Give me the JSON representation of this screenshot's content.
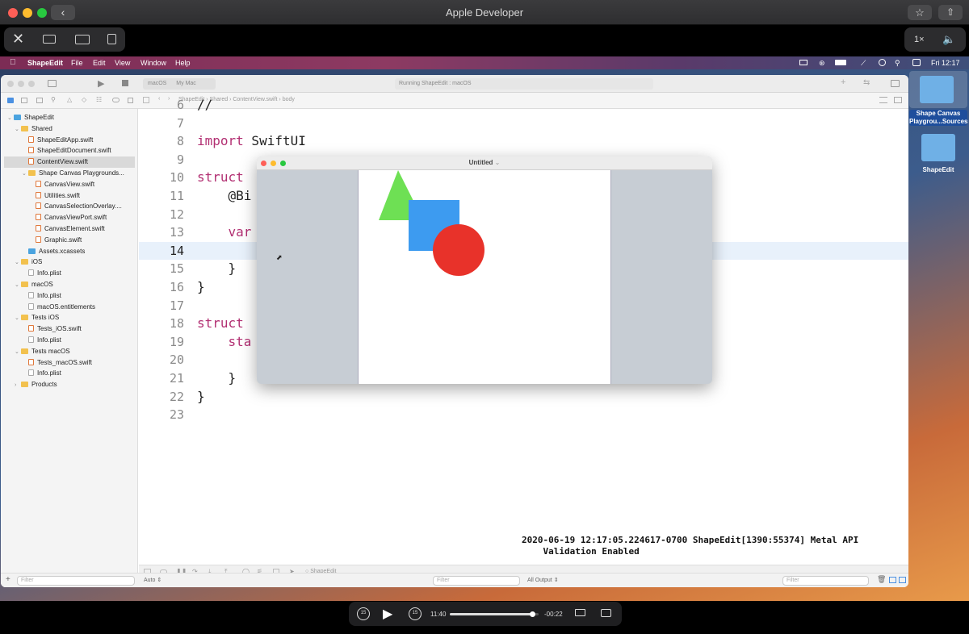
{
  "player": {
    "title": "Apple Developer",
    "speed": "1×",
    "time_elapsed": "11:40",
    "time_remaining": "-00:22",
    "progress": 0.93,
    "skip_back": "15",
    "skip_fwd": "15"
  },
  "menubar": {
    "app": "ShapeEdit",
    "items": [
      "File",
      "Edit",
      "View",
      "Window",
      "Help"
    ],
    "clock": "Fri 12:17"
  },
  "xcode": {
    "scheme_target": "macOS",
    "scheme_device": "My Mac",
    "status": "Running ShapeEdit : macOS",
    "breadcrumb": [
      "ShapeEdit",
      "Shared",
      "ContentView.swift",
      "body"
    ],
    "debug_target": "ShapeEdit",
    "auto_label": "Auto",
    "all_output_label": "All Output",
    "filter_placeholder": "Filter"
  },
  "navigator": [
    {
      "label": "ShapeEdit",
      "icon": "bfold",
      "indent": 0,
      "chev": "v"
    },
    {
      "label": "Shared",
      "icon": "fold",
      "indent": 1,
      "chev": "v"
    },
    {
      "label": "ShapeEditApp.swift",
      "icon": "swift",
      "indent": 2
    },
    {
      "label": "ShapeEditDocument.swift",
      "icon": "swift",
      "indent": 2
    },
    {
      "label": "ContentView.swift",
      "icon": "swift",
      "indent": 2,
      "selected": true
    },
    {
      "label": "Shape Canvas Playgrounds...",
      "icon": "fold",
      "indent": 2,
      "chev": "v"
    },
    {
      "label": "CanvasView.swift",
      "icon": "swift",
      "indent": 3
    },
    {
      "label": "Utilities.swift",
      "icon": "swift",
      "indent": 3
    },
    {
      "label": "CanvasSelectionOverlay....",
      "icon": "swift",
      "indent": 3
    },
    {
      "label": "CanvasViewPort.swift",
      "icon": "swift",
      "indent": 3
    },
    {
      "label": "CanvasElement.swift",
      "icon": "swift",
      "indent": 3
    },
    {
      "label": "Graphic.swift",
      "icon": "swift",
      "indent": 3
    },
    {
      "label": "Assets.xcassets",
      "icon": "bfold",
      "indent": 2
    },
    {
      "label": "iOS",
      "icon": "fold",
      "indent": 1,
      "chev": "v"
    },
    {
      "label": "Info.plist",
      "icon": "plist",
      "indent": 2
    },
    {
      "label": "macOS",
      "icon": "fold",
      "indent": 1,
      "chev": "v"
    },
    {
      "label": "Info.plist",
      "icon": "plist",
      "indent": 2
    },
    {
      "label": "macOS.entitlements",
      "icon": "plist",
      "indent": 2
    },
    {
      "label": "Tests iOS",
      "icon": "fold",
      "indent": 1,
      "chev": "v"
    },
    {
      "label": "Tests_iOS.swift",
      "icon": "swift",
      "indent": 2
    },
    {
      "label": "Info.plist",
      "icon": "plist",
      "indent": 2
    },
    {
      "label": "Tests macOS",
      "icon": "fold",
      "indent": 1,
      "chev": "v"
    },
    {
      "label": "Tests_macOS.swift",
      "icon": "swift",
      "indent": 2
    },
    {
      "label": "Info.plist",
      "icon": "plist",
      "indent": 2
    },
    {
      "label": "Products",
      "icon": "fold",
      "indent": 1,
      "chev": ">"
    }
  ],
  "code_lines": [
    {
      "n": "6",
      "kw": "",
      "rest": "//"
    },
    {
      "n": "7",
      "kw": "",
      "rest": ""
    },
    {
      "n": "8",
      "kw": "import",
      "rest": " SwiftUI"
    },
    {
      "n": "9",
      "kw": "",
      "rest": ""
    },
    {
      "n": "10",
      "kw": "struct",
      "rest": ""
    },
    {
      "n": "11",
      "kw": "",
      "rest": "    @Bi"
    },
    {
      "n": "12",
      "kw": "",
      "rest": ""
    },
    {
      "n": "13",
      "kw": "    var",
      "rest": ""
    },
    {
      "n": "14",
      "kw": "",
      "rest": ""
    },
    {
      "n": "15",
      "kw": "",
      "rest": "    }"
    },
    {
      "n": "16",
      "kw": "",
      "rest": "}"
    },
    {
      "n": "17",
      "kw": "",
      "rest": ""
    },
    {
      "n": "18",
      "kw": "struct",
      "rest": ""
    },
    {
      "n": "19",
      "kw": "    sta",
      "rest": ""
    },
    {
      "n": "20",
      "kw": "",
      "rest": "                                                ))"
    },
    {
      "n": "21",
      "kw": "",
      "rest": "    }"
    },
    {
      "n": "22",
      "kw": "",
      "rest": "}"
    },
    {
      "n": "23",
      "kw": "",
      "rest": ""
    }
  ],
  "console_line1": "2020-06-19 12:17:05.224617-0700 ShapeEdit[1390:55374] Metal API",
  "console_line2": "    Validation Enabled",
  "untitled_title": "Untitled",
  "desktop": [
    {
      "label1": "Shape Canvas",
      "label2": "Playgrou...Sources"
    },
    {
      "label1": "ShapeEdit",
      "label2": ""
    }
  ],
  "colors": {
    "triangle": "#6ee054",
    "square": "#3d9bf0",
    "circle": "#e8322a",
    "keyword": "#b22f72"
  }
}
